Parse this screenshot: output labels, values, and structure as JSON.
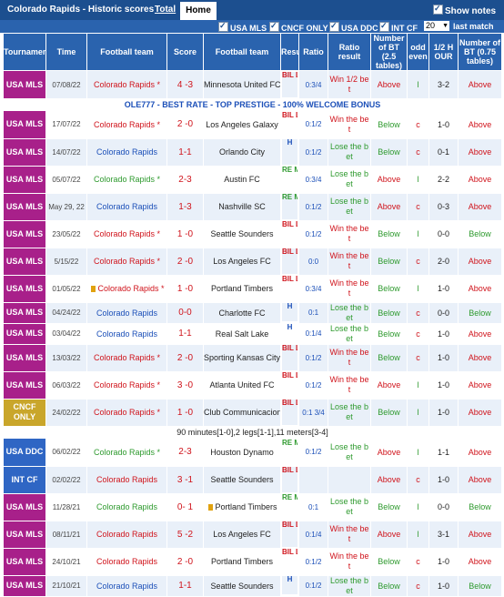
{
  "header": {
    "title": "Colorado Rapids - Historic scores",
    "tab_total": "Total",
    "tab_home": "Home",
    "show_notes": "Show notes"
  },
  "filters": {
    "usa_mls": "USA MLS",
    "cncf_only": "CNCF ONLY",
    "usa_ddc": "USA DDC",
    "int_cf": "INT CF",
    "count_selected": "20",
    "last_match": "last match"
  },
  "columns": {
    "tournament": "Tournaments",
    "time": "Time",
    "home_team": "Football team",
    "score": "Score",
    "away_team": "Football team",
    "result": "Result",
    "ratio": "Ratio",
    "ratio_result": "Ratio result",
    "number_bt": "Number of BT (2.5 tables)",
    "odd_even": "odd even",
    "half": "1/2 H OUR",
    "number_bt2": "Number of BT (0.75 tables)"
  },
  "colors": {
    "USA MLS": "#a8208a",
    "CNCF ONLY": "#c9a62b",
    "USA DDC": "#2f66c4",
    "INT CF": "#2f66c4"
  },
  "banner": "OLE777 - BEST RATE - TOP PRESTIGE - 100% WELCOME BONUS",
  "note_row": "90 minutes[1-0],2 legs[1-1],11 meters[3-4]",
  "matches": [
    {
      "league": "USA MLS",
      "date": "07/08/22",
      "home": "Colorado Rapids *",
      "home_color": "red",
      "score": "4 -3",
      "away": "Minnesota United FC",
      "result": "BIL LIO N",
      "result_class": "lose",
      "ratio": "0:3/4",
      "rr": "Win 1/2 be t",
      "rr_class": "red",
      "bt": "Above",
      "bt_class": "red",
      "oe": "l",
      "half": "3-2",
      "bt2": "Above",
      "bt2_class": "red"
    },
    {
      "league": "USA MLS",
      "date": "17/07/22",
      "home": "Colorado Rapids *",
      "home_color": "red",
      "score": "2 -0",
      "away": "Los Angeles Galaxy",
      "result": "BIL LIO N",
      "result_class": "lose",
      "ratio": "0:1/2",
      "rr": "Win the be t",
      "rr_class": "red",
      "bt": "Below",
      "bt_class": "green",
      "oe": "c",
      "half": "1-0",
      "bt2": "Above",
      "bt2_class": "red"
    },
    {
      "league": "USA MLS",
      "date": "14/07/22",
      "home": "Colorado Rapids",
      "home_color": "blue",
      "score": "1-1",
      "away": "Orlando City",
      "result": "H",
      "result_class": "draw",
      "ratio": "0:1/2",
      "rr": "Lose the b et",
      "rr_class": "green",
      "bt": "Below",
      "bt_class": "green",
      "oe": "c",
      "half": "0-1",
      "bt2": "Above",
      "bt2_class": "red"
    },
    {
      "league": "USA MLS",
      "date": "05/07/22",
      "home": "Colorado Rapids *",
      "home_color": "green",
      "score": "2-3",
      "away": "Austin FC",
      "result": "RE MO VE",
      "result_class": "win",
      "ratio": "0:3/4",
      "rr": "Lose the b et",
      "rr_class": "green",
      "bt": "Above",
      "bt_class": "red",
      "oe": "l",
      "half": "2-2",
      "bt2": "Above",
      "bt2_class": "red"
    },
    {
      "league": "USA MLS",
      "date": "May 29, 22",
      "home": "Colorado Rapids",
      "home_color": "blue",
      "score": "1-3",
      "away": "Nashville SC",
      "result": "RE MO VE",
      "result_class": "win",
      "ratio": "0:1/2",
      "rr": "Lose the b et",
      "rr_class": "green",
      "bt": "Above",
      "bt_class": "red",
      "oe": "c",
      "half": "0-3",
      "bt2": "Above",
      "bt2_class": "red"
    },
    {
      "league": "USA MLS",
      "date": "23/05/22",
      "home": "Colorado Rapids *",
      "home_color": "red",
      "score": "1 -0",
      "away": "Seattle Sounders",
      "result": "BIL LIO N",
      "result_class": "lose",
      "ratio": "0:1/2",
      "rr": "Win the be t",
      "rr_class": "red",
      "bt": "Below",
      "bt_class": "green",
      "oe": "l",
      "half": "0-0",
      "bt2": "Below",
      "bt2_class": "green"
    },
    {
      "league": "USA MLS",
      "date": "5/15/22",
      "home": "Colorado Rapids *",
      "home_color": "red",
      "score": "2 -0",
      "away": "Los Angeles FC",
      "result": "BIL LIO N",
      "result_class": "lose",
      "ratio": "0:0",
      "rr": "Win the be t",
      "rr_class": "red",
      "bt": "Below",
      "bt_class": "green",
      "oe": "c",
      "half": "2-0",
      "bt2": "Above",
      "bt2_class": "red"
    },
    {
      "league": "USA MLS",
      "date": "01/05/22",
      "home": "Colorado Rapids *",
      "home_color": "red",
      "score": "1 -0",
      "away": "Portland Timbers",
      "result": "BIL LIO N",
      "result_class": "lose",
      "ratio": "0:3/4",
      "rr": "Win the be t",
      "rr_class": "red",
      "bt": "Below",
      "bt_class": "green",
      "oe": "l",
      "half": "1-0",
      "bt2": "Above",
      "bt2_class": "red",
      "flag": true
    },
    {
      "league": "USA MLS",
      "date": "04/24/22",
      "home": "Colorado Rapids",
      "home_color": "blue",
      "score": "0-0",
      "away": "Charlotte FC",
      "result": "H",
      "result_class": "draw",
      "ratio": "0:1",
      "rr": "Lose the b et",
      "rr_class": "green",
      "bt": "Below",
      "bt_class": "green",
      "oe": "c",
      "half": "0-0",
      "bt2": "Below",
      "bt2_class": "green",
      "short": true
    },
    {
      "league": "USA MLS",
      "date": "03/04/22",
      "home": "Colorado Rapids",
      "home_color": "blue",
      "score": "1-1",
      "away": "Real Salt Lake",
      "result": "H",
      "result_class": "draw",
      "ratio": "0:1/4",
      "rr": "Lose the b et",
      "rr_class": "green",
      "bt": "Below",
      "bt_class": "green",
      "oe": "c",
      "half": "1-0",
      "bt2": "Above",
      "bt2_class": "red",
      "short": true
    },
    {
      "league": "USA MLS",
      "date": "13/03/22",
      "home": "Colorado Rapids *",
      "home_color": "red",
      "score": "2 -0",
      "away": "Sporting Kansas City",
      "result": "BIL LIO N",
      "result_class": "lose",
      "ratio": "0:1/2",
      "rr": "Win the be t",
      "rr_class": "red",
      "bt": "Below",
      "bt_class": "green",
      "oe": "c",
      "half": "1-0",
      "bt2": "Above",
      "bt2_class": "red"
    },
    {
      "league": "USA MLS",
      "date": "06/03/22",
      "home": "Colorado Rapids *",
      "home_color": "red",
      "score": "3 -0",
      "away": "Atlanta United FC",
      "result": "BIL LIO N",
      "result_class": "lose",
      "ratio": "0:1/2",
      "rr": "Win the be t",
      "rr_class": "red",
      "bt": "Above",
      "bt_class": "red",
      "oe": "l",
      "half": "1-0",
      "bt2": "Above",
      "bt2_class": "red"
    },
    {
      "league": "CNCF ONLY",
      "date": "24/02/22",
      "home": "Colorado Rapids *",
      "home_color": "red",
      "score": "1 -0",
      "away": "Club Communicacione s",
      "result": "BIL LIO N",
      "result_class": "lose",
      "ratio": "0:1 3/4",
      "rr": "Lose the b et",
      "rr_class": "green",
      "bt": "Below",
      "bt_class": "green",
      "oe": "l",
      "half": "1-0",
      "bt2": "Above",
      "bt2_class": "red"
    },
    {
      "league": "USA DDC",
      "date": "06/02/22",
      "home": "Colorado Rapids *",
      "home_color": "green",
      "score": "2-3",
      "away": "Houston Dynamo",
      "result": "RE MO VE",
      "result_class": "win",
      "ratio": "0:1/2",
      "rr": "Lose the b et",
      "rr_class": "green",
      "bt": "Above",
      "bt_class": "red",
      "oe": "l",
      "half": "1-1",
      "bt2": "Above",
      "bt2_class": "red",
      "note_before": true
    },
    {
      "league": "INT CF",
      "date": "02/02/22",
      "home": "Colorado Rapids",
      "home_color": "red",
      "score": "3 -1",
      "away": "Seattle Sounders",
      "result": "BIL LIO N",
      "result_class": "lose",
      "ratio": "",
      "rr": "",
      "rr_class": "red",
      "bt": "Above",
      "bt_class": "red",
      "oe": "c",
      "half": "1-0",
      "bt2": "Above",
      "bt2_class": "red"
    },
    {
      "league": "USA MLS",
      "date": "11/28/21",
      "home": "Colorado Rapids",
      "home_color": "green",
      "score": "0- 1",
      "away": "Portland Timbers",
      "result": "RE MO VE",
      "result_class": "win",
      "ratio": "0:1",
      "rr": "Lose the b et",
      "rr_class": "green",
      "bt": "Below",
      "bt_class": "green",
      "oe": "l",
      "half": "0-0",
      "bt2": "Below",
      "bt2_class": "green",
      "flag_away": true
    },
    {
      "league": "USA MLS",
      "date": "08/11/21",
      "home": "Colorado Rapids",
      "home_color": "red",
      "score": "5 -2",
      "away": "Los Angeles FC",
      "result": "BIL LIO N",
      "result_class": "lose",
      "ratio": "0:1/4",
      "rr": "Win the be t",
      "rr_class": "red",
      "bt": "Above",
      "bt_class": "red",
      "oe": "l",
      "half": "3-1",
      "bt2": "Above",
      "bt2_class": "red"
    },
    {
      "league": "USA MLS",
      "date": "24/10/21",
      "home": "Colorado Rapids",
      "home_color": "red",
      "score": "2 -0",
      "away": "Portland Timbers",
      "result": "BIL LIO N",
      "result_class": "lose",
      "ratio": "0:1/2",
      "rr": "Win the be t",
      "rr_class": "red",
      "bt": "Below",
      "bt_class": "green",
      "oe": "c",
      "half": "1-0",
      "bt2": "Above",
      "bt2_class": "red"
    },
    {
      "league": "USA MLS",
      "date": "21/10/21",
      "home": "Colorado Rapids",
      "home_color": "blue",
      "score": "1-1",
      "away": "Seattle Sounders",
      "result": "H",
      "result_class": "draw",
      "ratio": "0:1/2",
      "rr": "Lose the b et",
      "rr_class": "green",
      "bt": "Below",
      "bt_class": "green",
      "oe": "c",
      "half": "1-0",
      "bt2": "Below",
      "bt2_class": "green",
      "short": true
    }
  ]
}
